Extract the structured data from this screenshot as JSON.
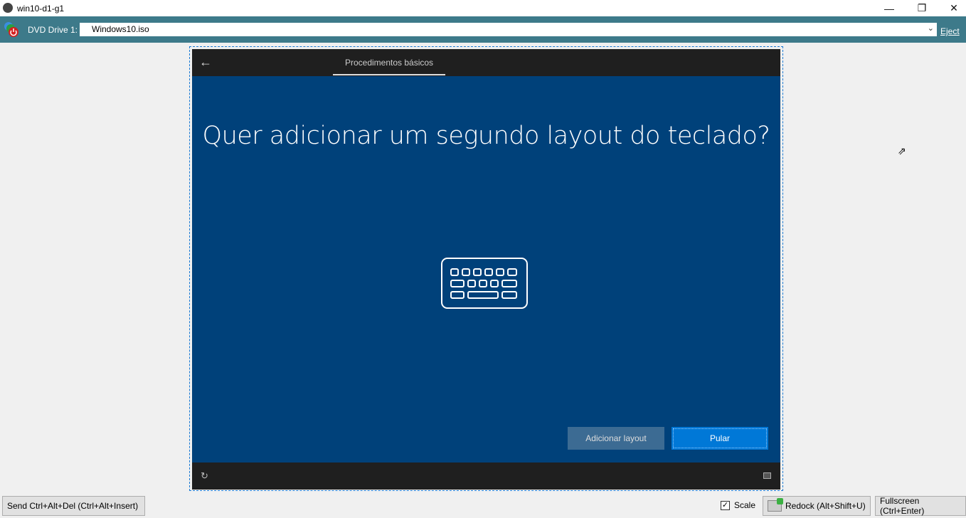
{
  "window": {
    "title": "win10-d1-g1"
  },
  "toolbar": {
    "dvd_label": "DVD Drive 1:",
    "iso_value": "Windows10.iso",
    "eject_label": "Eject"
  },
  "vm": {
    "tab_label": "Procedimentos básicos",
    "question": "Quer adicionar um segundo layout do teclado?",
    "add_layout_label": "Adicionar layout",
    "skip_label": "Pular"
  },
  "bottom": {
    "cad_label": "Send Ctrl+Alt+Del (Ctrl+Alt+Insert)",
    "scale_label": "Scale",
    "scale_checked": true,
    "redock_label": "Redock (Alt+Shift+U)",
    "fullscreen_label": "Fullscreen (Ctrl+Enter)"
  },
  "colors": {
    "toolbar": "#3d7a8a",
    "vm_background": "#00417a",
    "primary_button": "#0078d7"
  }
}
